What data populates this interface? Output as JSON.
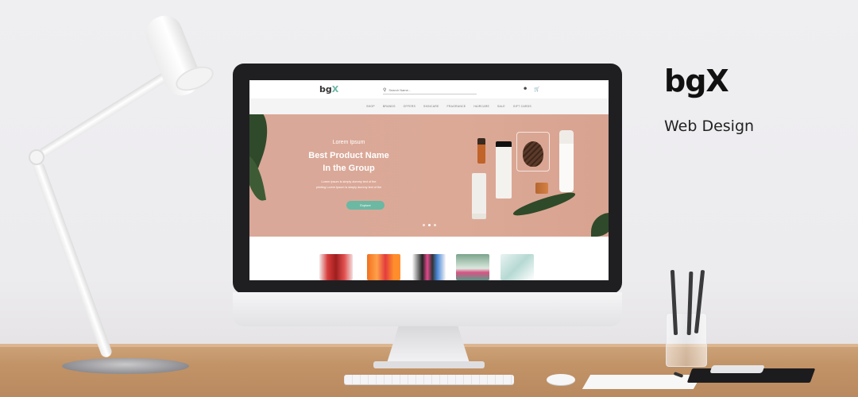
{
  "brand": {
    "name": "bgX",
    "tagline": "Web Design"
  },
  "website": {
    "logo": {
      "main": "bg",
      "accent": "X"
    },
    "search": {
      "placeholder": "Search Name..."
    },
    "header_icons": [
      "user-icon",
      "cart-icon"
    ],
    "nav": {
      "items": [
        "Shop",
        "Brands",
        "Offers",
        "Skincare",
        "Fragrance",
        "Haircare",
        "Sale",
        "Gift Cards"
      ]
    },
    "hero": {
      "kicker": "Lorem Ipsum",
      "title_line1": "Best Product Name",
      "title_line2": "In the Group",
      "desc_line1": "Lorem Ipsum is simply dummy text of the",
      "desc_line2": "printing Lorem Ipsum is simply dummy text of the",
      "cta": "Explore",
      "slides": 3,
      "active_slide": 2
    },
    "products": [
      "Product 1",
      "Product 2",
      "Product 3",
      "Product 4",
      "Product 5"
    ]
  },
  "colors": {
    "accent": "#6bb8a3",
    "hero_bg": "#d9a898",
    "brand_text": "#111111"
  }
}
